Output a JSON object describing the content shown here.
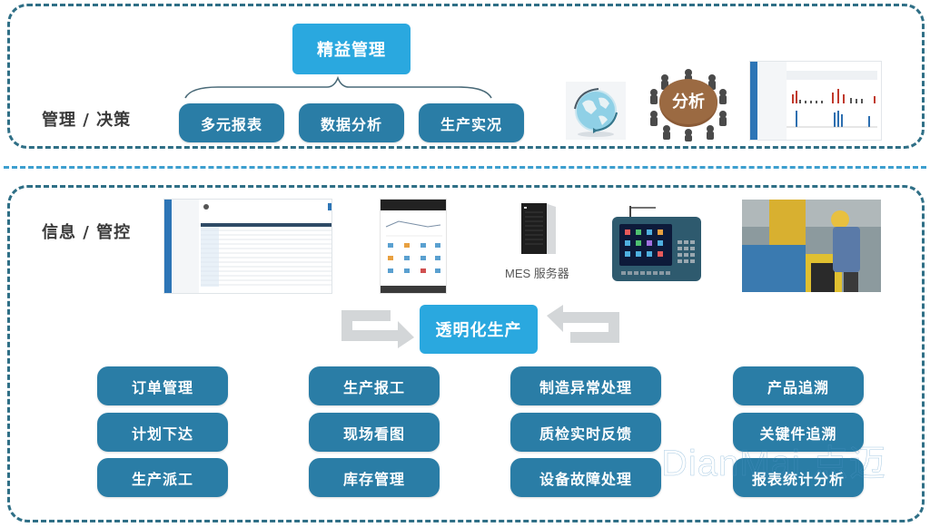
{
  "top_section": {
    "label": "管理 / 决策",
    "root_button": "精益管理",
    "sub_buttons": [
      "多元报表",
      "数据分析",
      "生产实况"
    ],
    "images": {
      "globe": "globe-icon",
      "analysis": {
        "icon": "meeting-table-icon",
        "label": "分析"
      },
      "report": "report-screenshot"
    }
  },
  "bottom_section": {
    "label": "信息 / 管控",
    "images": {
      "web": "web-app-screenshot",
      "phone": "mobile-app-screenshot",
      "server": {
        "icon": "server-icon",
        "caption": "MES 服务器"
      },
      "terminal": "handheld-terminal-icon",
      "factory": "factory-photo"
    },
    "center_button": "透明化生产",
    "columns": [
      [
        "订单管理",
        "计划下达",
        "生产派工"
      ],
      [
        "生产报工",
        "现场看图",
        "库存管理"
      ],
      [
        "制造异常处理",
        "质检实时反馈",
        "设备故障处理"
      ],
      [
        "产品追溯",
        "关键件追溯",
        "报表统计分析"
      ]
    ]
  },
  "watermark": "DianMai 点迈",
  "colors": {
    "primary_light": "#2aa8df",
    "primary_dark": "#2a7da6",
    "frame": "#2f6f86",
    "arrow": "#d3d6d8"
  }
}
